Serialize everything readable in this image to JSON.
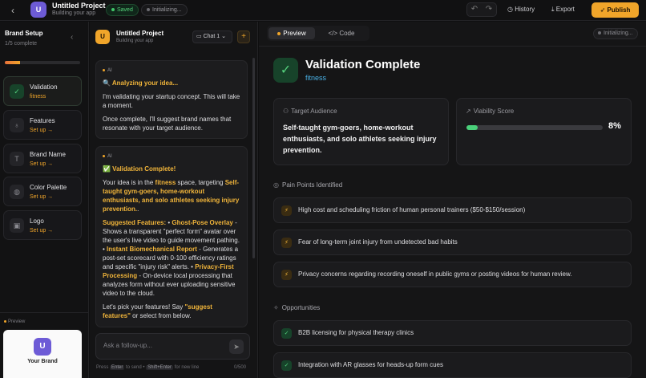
{
  "topbar": {
    "back_icon": "chevron-left-icon",
    "avatar_letter": "U",
    "project_title": "Untitled Project",
    "project_subtitle": "Building your app",
    "saved_label": "Saved",
    "init_label": "Initializing...",
    "history_label": "History",
    "export_label": "Export",
    "publish_label": "Publish"
  },
  "sidebar": {
    "title": "Brand Setup",
    "progress_text": "1/5 complete",
    "progress_fraction": 0.2,
    "steps": [
      {
        "label": "Validation",
        "status": "fitness",
        "icon": "check-icon"
      },
      {
        "label": "Features",
        "status": "Set up →",
        "icon": "lightbulb-icon"
      },
      {
        "label": "Brand Name",
        "status": "Set up →",
        "icon": "type-icon"
      },
      {
        "label": "Color Palette",
        "status": "Set up →",
        "icon": "palette-icon"
      },
      {
        "label": "Logo",
        "status": "Set up →",
        "icon": "image-icon"
      }
    ],
    "preview_label": "Preview",
    "brand_card": {
      "letter": "U",
      "name": "Your Brand"
    }
  },
  "chat": {
    "avatar_letter": "U",
    "title": "Untitled Project",
    "subtitle": "Building your app",
    "chat_select": "Chat 1",
    "message1": {
      "tag": "AI",
      "heading": "🔍 Analyzing your idea...",
      "p1": "I'm validating your startup concept. This will take a moment.",
      "p2": "Once complete, I'll suggest brand names that resonate with your target audience."
    },
    "message2": {
      "tag": "AI",
      "heading": "✅ Validation Complete!",
      "intro_a": "Your idea is in the ",
      "intro_space": "fitness",
      "intro_b": " space, targeting ",
      "intro_audience": "Self-taught gym-goers, home-workout enthusiasts, and solo athletes seeking injury prevention.",
      "intro_end": ".",
      "features_title": "Suggested Features:",
      "f1_name": "Ghost-Pose Overlay",
      "f1_text": " - Shows a transparent \"perfect form\" avatar over the user's live video to guide movement pathing. ",
      "f2_name": "Instant Biomechanical Report",
      "f2_text": " - Generates a post-set scorecard with 0-100 efficiency ratings and specific \"injury risk\" alerts. ",
      "f3_name": "Privacy-First Processing",
      "f3_text": " - On-device local processing that analyzes form without ever uploading sensitive video to the cloud.",
      "cta_a": "Let's pick your features! Say ",
      "cta_quote": "\"suggest features\"",
      "cta_b": " or select from below."
    },
    "input_placeholder": "Ask a follow-up...",
    "hint_a": "Press",
    "hint_enter": "Enter",
    "hint_b": "to send •",
    "hint_shift": "Shift+Enter",
    "hint_c": "for new line",
    "char_count": "0/500"
  },
  "preview": {
    "tab_preview": "Preview",
    "tab_code": "</> Code",
    "init_label": "Initializing...",
    "title": "Validation Complete",
    "category": "fitness",
    "target_label": "Target Audience",
    "target_text": "Self-taught gym-goers, home-workout enthusiasts, and solo athletes seeking injury prevention.",
    "viability_label": "Viability Score",
    "viability_value": "8%",
    "viability_fraction": 0.08,
    "pain_title": "Pain Points Identified",
    "pain_points": [
      "High cost and scheduling friction of human personal trainers ($50-$150/session)",
      "Fear of long-term joint injury from undetected bad habits",
      "Privacy concerns regarding recording oneself in public gyms or posting videos for human review."
    ],
    "opp_title": "Opportunities",
    "opportunities": [
      "B2B licensing for physical therapy clinics",
      "Integration with AR glasses for heads-up form cues"
    ]
  }
}
